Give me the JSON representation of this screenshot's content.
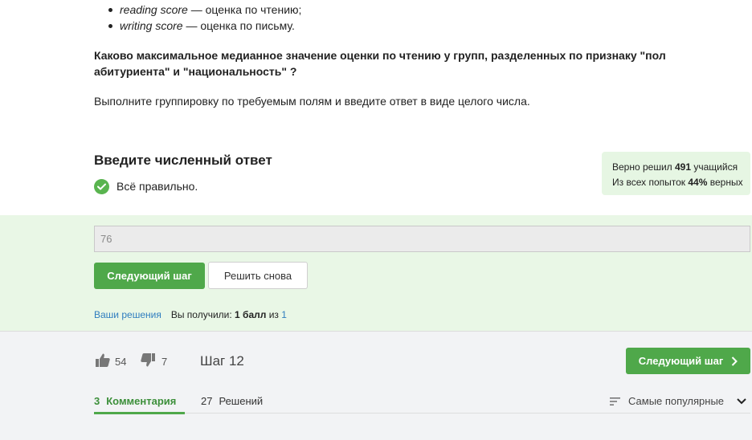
{
  "bullets": [
    {
      "term": "reading score",
      "desc": " — оценка по чтению;"
    },
    {
      "term": "writing score",
      "desc": " — оценка по письму."
    }
  ],
  "question": "Каково максимальное медианное значение оценки по чтению у групп, разделенных по признаку \"пол абитуриента\" и \"национальность\" ?",
  "instruction": "Выполните группировку по требуемым полям и введите ответ в виде целого числа.",
  "answer_title": "Введите численный ответ",
  "result_text": "Всё правильно.",
  "stats": {
    "line1_prefix": "Верно решил ",
    "solved_count": "491",
    "line1_suffix": " учащийся",
    "line2_prefix": "Из всех попыток ",
    "percent": "44%",
    "line2_suffix": " верных"
  },
  "answer_input": {
    "value": "76"
  },
  "buttons": {
    "next_step": "Следующий шаг",
    "retry": "Решить снова"
  },
  "solutions": {
    "link": "Ваши решения",
    "received_prefix": "Вы получили: ",
    "points": "1 балл",
    "of": " из ",
    "max": "1"
  },
  "votes": {
    "likes": "54",
    "dislikes": "7"
  },
  "step": "Шаг 12",
  "tabs": [
    {
      "count": "3",
      "label": "Комментария"
    },
    {
      "count": "27",
      "label": "Решений"
    }
  ],
  "sort_label": "Самые популярные",
  "colors": {
    "accent": "#4fa84a",
    "success_bg": "#e9f7e6",
    "link": "#2f7dbf"
  },
  "icons": [
    "check-icon",
    "thumbs-up-icon",
    "thumbs-down-icon",
    "chevron-right-icon",
    "sort-icon",
    "chevron-down-icon"
  ]
}
